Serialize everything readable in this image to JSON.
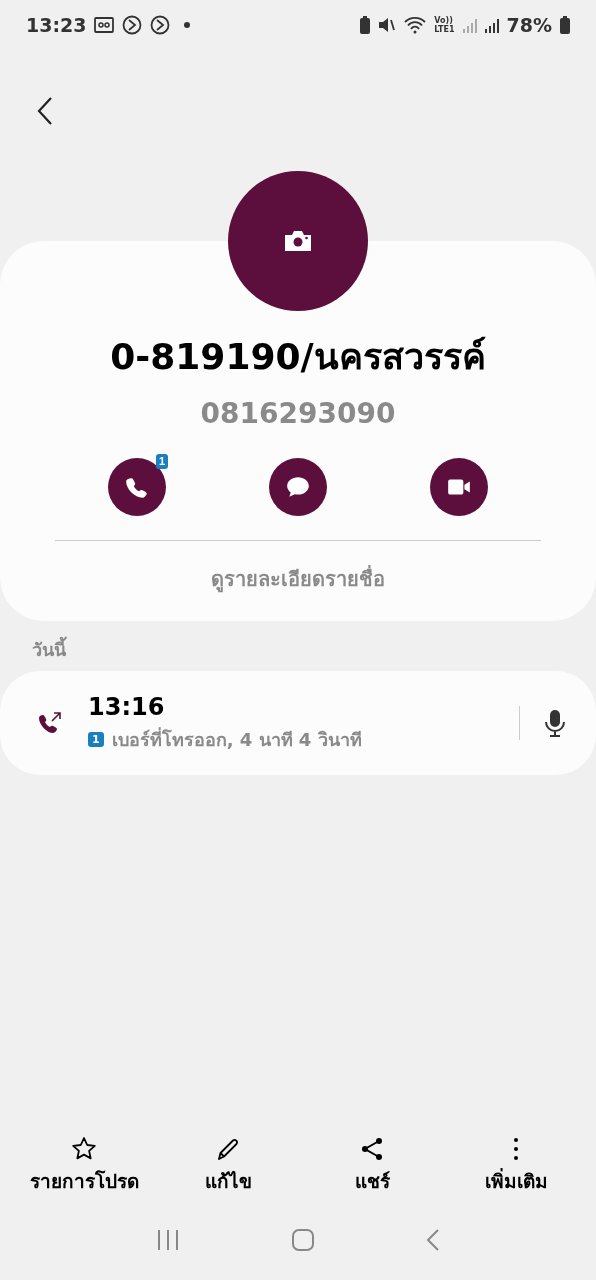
{
  "status_bar": {
    "time": "13:23",
    "network_top": "Vo))",
    "network_bottom": "LTE1",
    "battery": "78%"
  },
  "contact": {
    "name": "0-819190/นครสวรรค์",
    "number": "0816293090",
    "actions": [
      {
        "kind": "call",
        "sim_badge": "1"
      },
      {
        "kind": "message"
      },
      {
        "kind": "video"
      }
    ],
    "details_link": "ดูรายละเอียดรายชื่อ"
  },
  "history": {
    "section_title": "วันนี้",
    "entries": [
      {
        "kind": "outgoing",
        "time": "13:16",
        "sim": "1",
        "description": "เบอร์ที่โทรออก, 4 นาที 4 วินาที"
      }
    ]
  },
  "bottom_actions": [
    {
      "kind": "favorite",
      "label": "รายการโปรด"
    },
    {
      "kind": "edit",
      "label": "แก้ไข"
    },
    {
      "kind": "share",
      "label": "แชร์"
    },
    {
      "kind": "more",
      "label": "เพิ่มเติม"
    }
  ]
}
